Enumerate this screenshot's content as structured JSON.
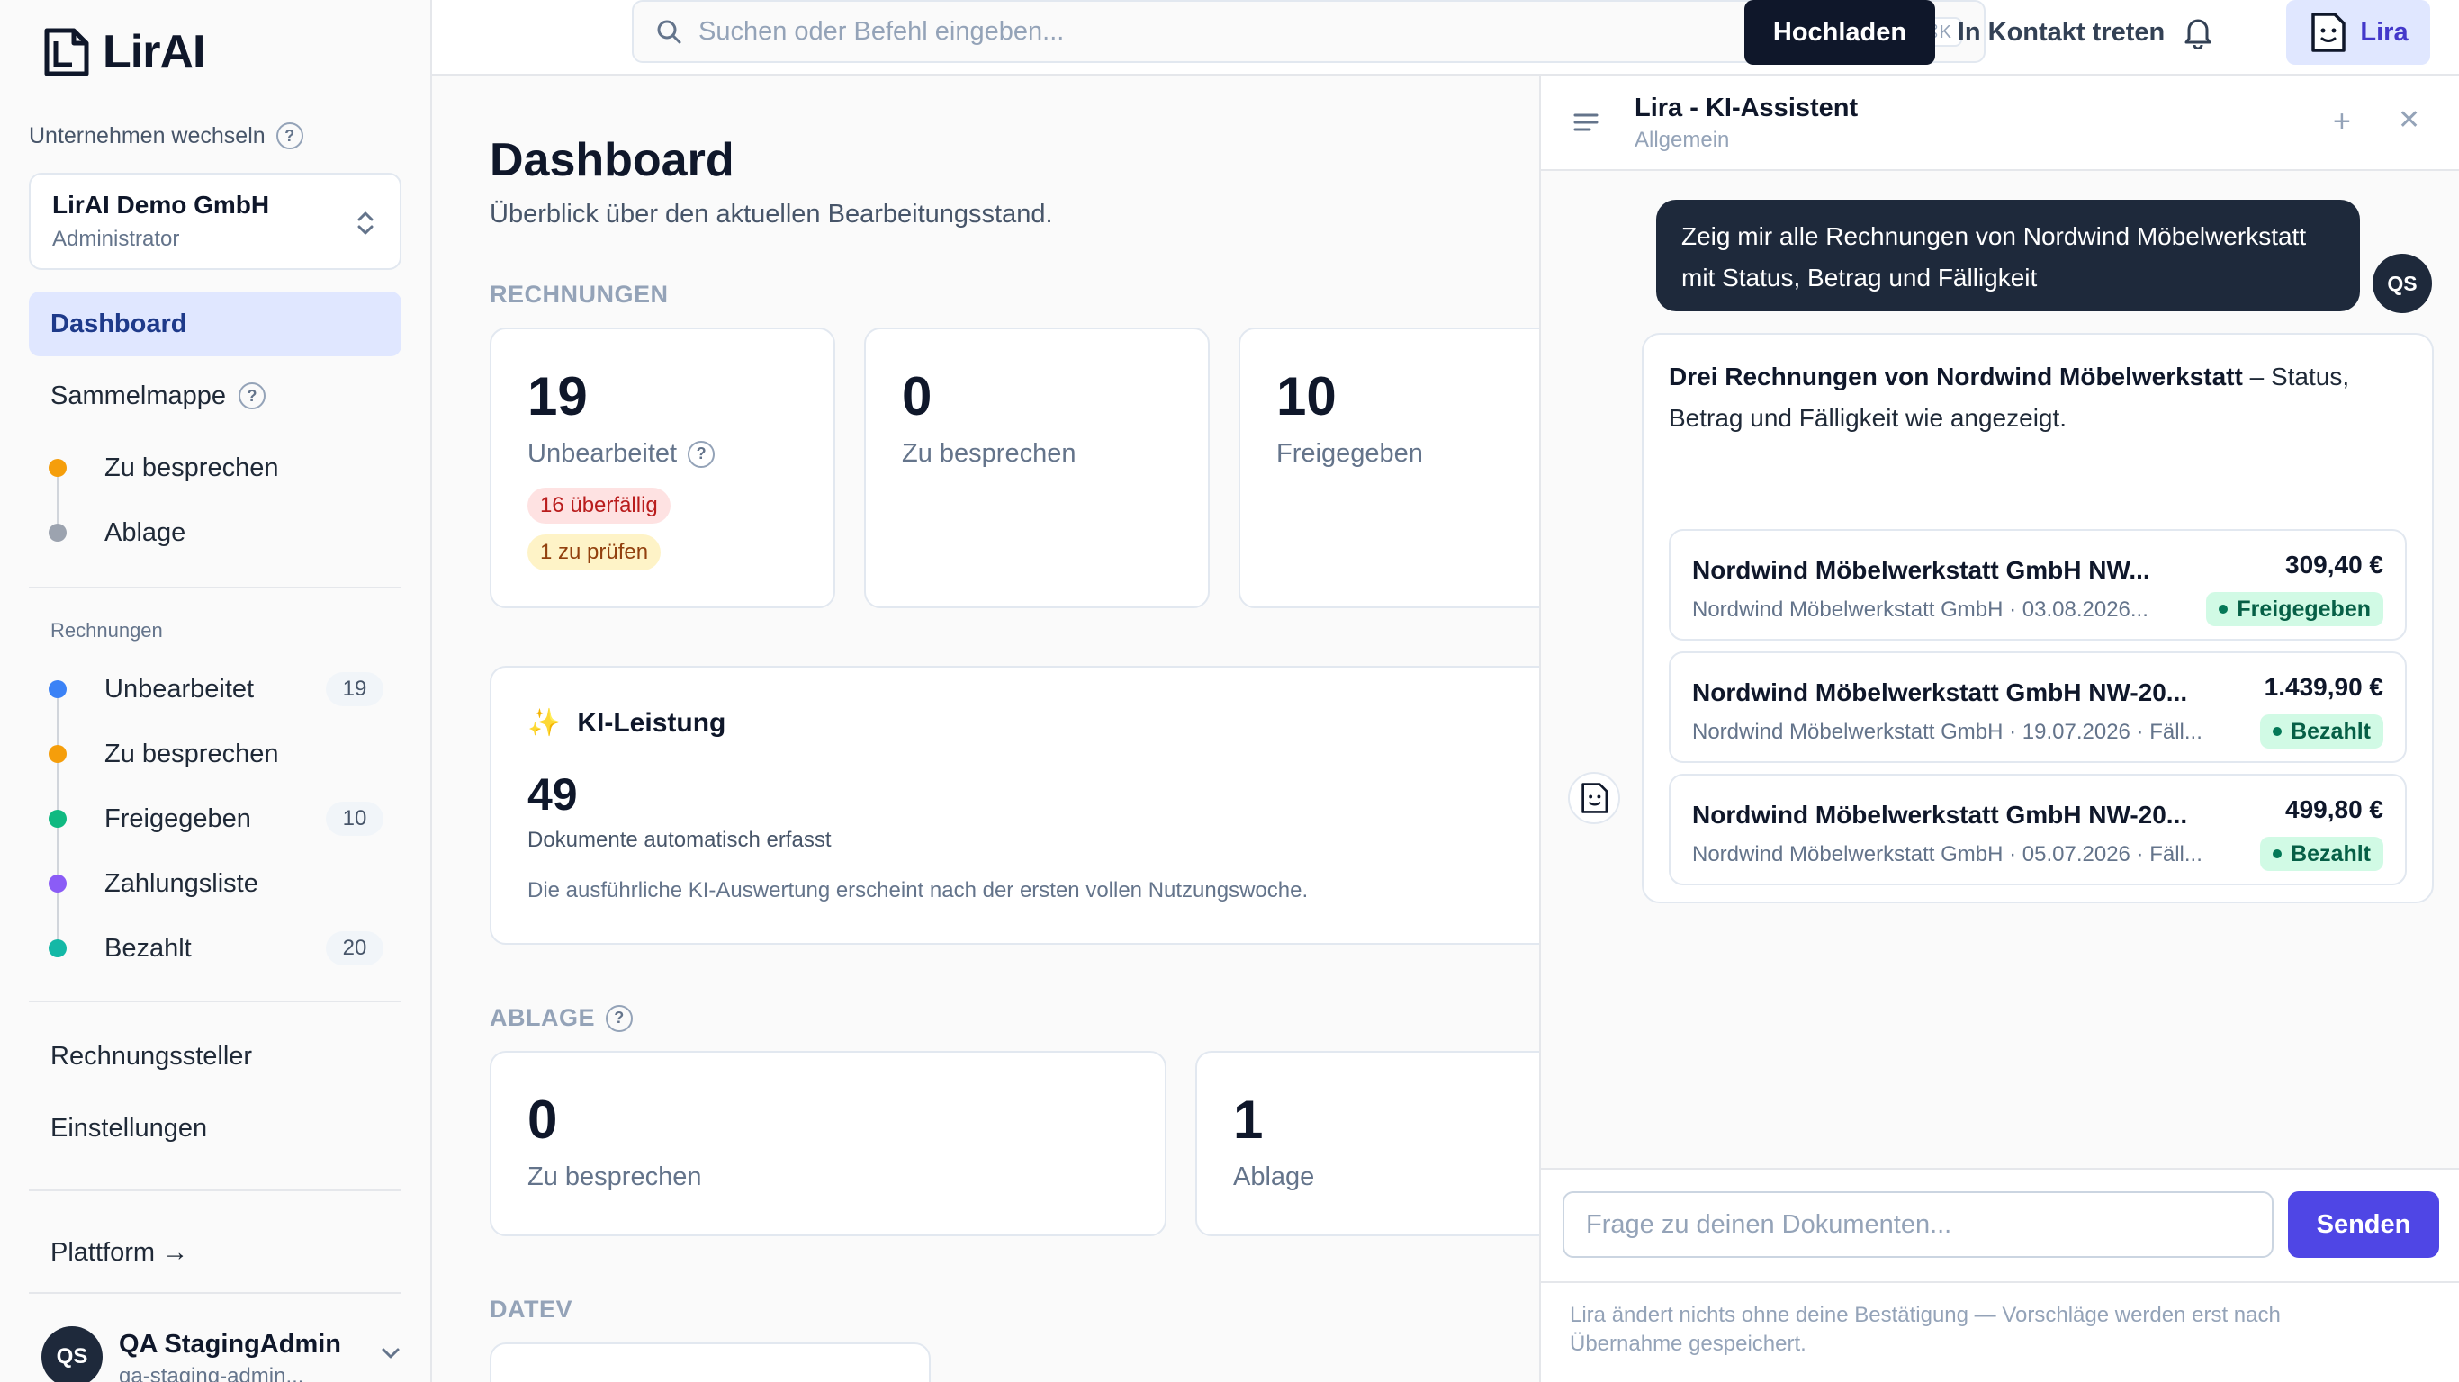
{
  "app": {
    "logo_text": "LirAI"
  },
  "sidebar": {
    "company_switch_label": "Unternehmen wechseln",
    "company": {
      "name": "LirAI Demo GmbH",
      "role": "Administrator"
    },
    "dashboard_label": "Dashboard",
    "sammelmappe": {
      "label": "Sammelmappe",
      "items": [
        {
          "label": "Zu besprechen",
          "color": "#f59e0b"
        },
        {
          "label": "Ablage",
          "color": "#9ca3af"
        }
      ]
    },
    "rechnungen": {
      "section_label": "Rechnungen",
      "items": [
        {
          "label": "Unbearbeitet",
          "color": "#3b82f6",
          "count": "19"
        },
        {
          "label": "Zu besprechen",
          "color": "#f59e0b",
          "count": ""
        },
        {
          "label": "Freigegeben",
          "color": "#10b981",
          "count": "10"
        },
        {
          "label": "Zahlungsliste",
          "color": "#8b5cf6",
          "count": ""
        },
        {
          "label": "Bezahlt",
          "color": "#14b8a6",
          "count": "20"
        }
      ]
    },
    "rechnungssteller_label": "Rechnungssteller",
    "einstellungen_label": "Einstellungen",
    "plattform_label": "Plattform →",
    "user": {
      "initials": "QS",
      "name": "QA StagingAdmin",
      "email": "qa-staging-admin..."
    }
  },
  "topbar": {
    "search_placeholder": "Suchen oder Befehl eingeben...",
    "search_shortcut": "⌘K",
    "upload_label": "Hochladen",
    "contact_label": "In Kontakt treten",
    "lira_label": "Lira"
  },
  "main": {
    "title": "Dashboard",
    "subtitle": "Überblick über den aktuellen Bearbeitungsstand.",
    "rechnungen_heading": "RECHNUNGEN",
    "rechnungen_cards": [
      {
        "value": "19",
        "label": "Unbearbeitet",
        "overdue": "16 überfällig",
        "to_check": "1 zu prüfen"
      },
      {
        "value": "0",
        "label": "Zu besprechen"
      },
      {
        "value": "10",
        "label": "Freigegeben"
      }
    ],
    "ki": {
      "icon": "✨",
      "title": "KI-Leistung",
      "value": "49",
      "description": "Dokumente automatisch erfasst",
      "note": "Die ausführliche KI-Auswertung erscheint nach der ersten vollen Nutzungswoche."
    },
    "ablage_heading": "ABLAGE",
    "ablage_cards": [
      {
        "value": "0",
        "label": "Zu besprechen"
      },
      {
        "value": "1",
        "label": "Ablage"
      }
    ],
    "datev_heading": "DATEV"
  },
  "chat": {
    "title": "Lira - KI-Assistent",
    "subtitle": "Allgemein",
    "user_message": "Zeig mir alle Rechnungen von Nordwind Möbelwerkstatt mit Status, Betrag und Fälligkeit",
    "user_initials": "QS",
    "ai_intro_bold": "Drei Rechnungen von Nordwind Möbelwerkstatt",
    "ai_intro_rest": " – Status, Betrag und Fälligkeit wie angezeigt.",
    "invoices": [
      {
        "title": "Nordwind Möbelwerkstatt GmbH NW...",
        "meta": "Nordwind Möbelwerkstatt GmbH · 03.08.2026...",
        "amount": "309,40 €",
        "status": "Freigegeben"
      },
      {
        "title": "Nordwind Möbelwerkstatt GmbH NW-20...",
        "meta": "Nordwind Möbelwerkstatt GmbH · 19.07.2026 · Fäll...",
        "amount": "1.439,90 €",
        "status": "Bezahlt"
      },
      {
        "title": "Nordwind Möbelwerkstatt GmbH NW-20...",
        "meta": "Nordwind Möbelwerkstatt GmbH · 05.07.2026 · Fäll...",
        "amount": "499,80 €",
        "status": "Bezahlt"
      }
    ],
    "input_placeholder": "Frage zu deinen Dokumenten...",
    "send_label": "Senden",
    "disclaimer": "Lira ändert nichts ohne deine Bestätigung — Vorschläge werden erst nach Übernahme gespeichert."
  }
}
